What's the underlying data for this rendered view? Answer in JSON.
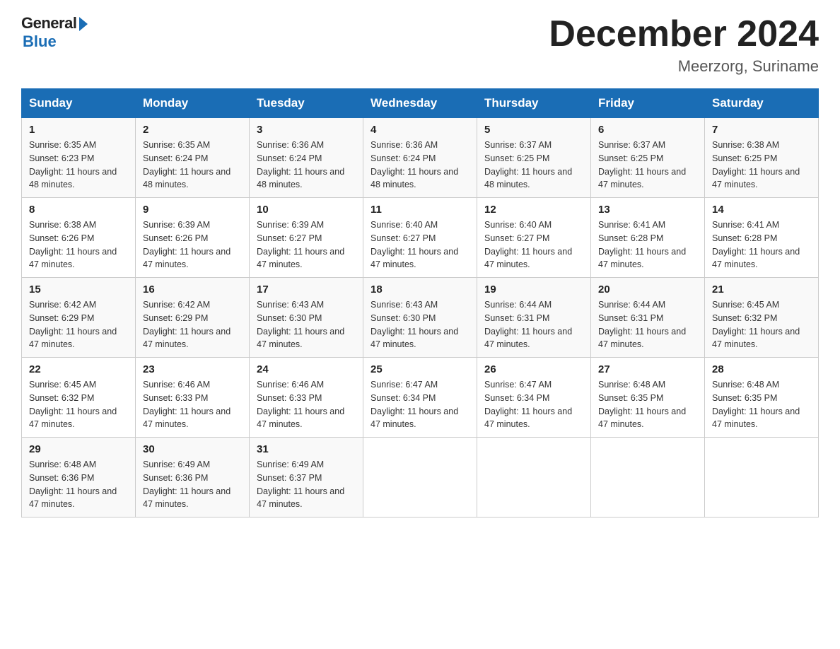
{
  "logo": {
    "general": "General",
    "blue": "Blue"
  },
  "title": "December 2024",
  "location": "Meerzorg, Suriname",
  "days_of_week": [
    "Sunday",
    "Monday",
    "Tuesday",
    "Wednesday",
    "Thursday",
    "Friday",
    "Saturday"
  ],
  "weeks": [
    [
      {
        "day": "1",
        "sunrise": "6:35 AM",
        "sunset": "6:23 PM",
        "daylight": "11 hours and 48 minutes."
      },
      {
        "day": "2",
        "sunrise": "6:35 AM",
        "sunset": "6:24 PM",
        "daylight": "11 hours and 48 minutes."
      },
      {
        "day": "3",
        "sunrise": "6:36 AM",
        "sunset": "6:24 PM",
        "daylight": "11 hours and 48 minutes."
      },
      {
        "day": "4",
        "sunrise": "6:36 AM",
        "sunset": "6:24 PM",
        "daylight": "11 hours and 48 minutes."
      },
      {
        "day": "5",
        "sunrise": "6:37 AM",
        "sunset": "6:25 PM",
        "daylight": "11 hours and 48 minutes."
      },
      {
        "day": "6",
        "sunrise": "6:37 AM",
        "sunset": "6:25 PM",
        "daylight": "11 hours and 47 minutes."
      },
      {
        "day": "7",
        "sunrise": "6:38 AM",
        "sunset": "6:25 PM",
        "daylight": "11 hours and 47 minutes."
      }
    ],
    [
      {
        "day": "8",
        "sunrise": "6:38 AM",
        "sunset": "6:26 PM",
        "daylight": "11 hours and 47 minutes."
      },
      {
        "day": "9",
        "sunrise": "6:39 AM",
        "sunset": "6:26 PM",
        "daylight": "11 hours and 47 minutes."
      },
      {
        "day": "10",
        "sunrise": "6:39 AM",
        "sunset": "6:27 PM",
        "daylight": "11 hours and 47 minutes."
      },
      {
        "day": "11",
        "sunrise": "6:40 AM",
        "sunset": "6:27 PM",
        "daylight": "11 hours and 47 minutes."
      },
      {
        "day": "12",
        "sunrise": "6:40 AM",
        "sunset": "6:27 PM",
        "daylight": "11 hours and 47 minutes."
      },
      {
        "day": "13",
        "sunrise": "6:41 AM",
        "sunset": "6:28 PM",
        "daylight": "11 hours and 47 minutes."
      },
      {
        "day": "14",
        "sunrise": "6:41 AM",
        "sunset": "6:28 PM",
        "daylight": "11 hours and 47 minutes."
      }
    ],
    [
      {
        "day": "15",
        "sunrise": "6:42 AM",
        "sunset": "6:29 PM",
        "daylight": "11 hours and 47 minutes."
      },
      {
        "day": "16",
        "sunrise": "6:42 AM",
        "sunset": "6:29 PM",
        "daylight": "11 hours and 47 minutes."
      },
      {
        "day": "17",
        "sunrise": "6:43 AM",
        "sunset": "6:30 PM",
        "daylight": "11 hours and 47 minutes."
      },
      {
        "day": "18",
        "sunrise": "6:43 AM",
        "sunset": "6:30 PM",
        "daylight": "11 hours and 47 minutes."
      },
      {
        "day": "19",
        "sunrise": "6:44 AM",
        "sunset": "6:31 PM",
        "daylight": "11 hours and 47 minutes."
      },
      {
        "day": "20",
        "sunrise": "6:44 AM",
        "sunset": "6:31 PM",
        "daylight": "11 hours and 47 minutes."
      },
      {
        "day": "21",
        "sunrise": "6:45 AM",
        "sunset": "6:32 PM",
        "daylight": "11 hours and 47 minutes."
      }
    ],
    [
      {
        "day": "22",
        "sunrise": "6:45 AM",
        "sunset": "6:32 PM",
        "daylight": "11 hours and 47 minutes."
      },
      {
        "day": "23",
        "sunrise": "6:46 AM",
        "sunset": "6:33 PM",
        "daylight": "11 hours and 47 minutes."
      },
      {
        "day": "24",
        "sunrise": "6:46 AM",
        "sunset": "6:33 PM",
        "daylight": "11 hours and 47 minutes."
      },
      {
        "day": "25",
        "sunrise": "6:47 AM",
        "sunset": "6:34 PM",
        "daylight": "11 hours and 47 minutes."
      },
      {
        "day": "26",
        "sunrise": "6:47 AM",
        "sunset": "6:34 PM",
        "daylight": "11 hours and 47 minutes."
      },
      {
        "day": "27",
        "sunrise": "6:48 AM",
        "sunset": "6:35 PM",
        "daylight": "11 hours and 47 minutes."
      },
      {
        "day": "28",
        "sunrise": "6:48 AM",
        "sunset": "6:35 PM",
        "daylight": "11 hours and 47 minutes."
      }
    ],
    [
      {
        "day": "29",
        "sunrise": "6:48 AM",
        "sunset": "6:36 PM",
        "daylight": "11 hours and 47 minutes."
      },
      {
        "day": "30",
        "sunrise": "6:49 AM",
        "sunset": "6:36 PM",
        "daylight": "11 hours and 47 minutes."
      },
      {
        "day": "31",
        "sunrise": "6:49 AM",
        "sunset": "6:37 PM",
        "daylight": "11 hours and 47 minutes."
      },
      null,
      null,
      null,
      null
    ]
  ]
}
